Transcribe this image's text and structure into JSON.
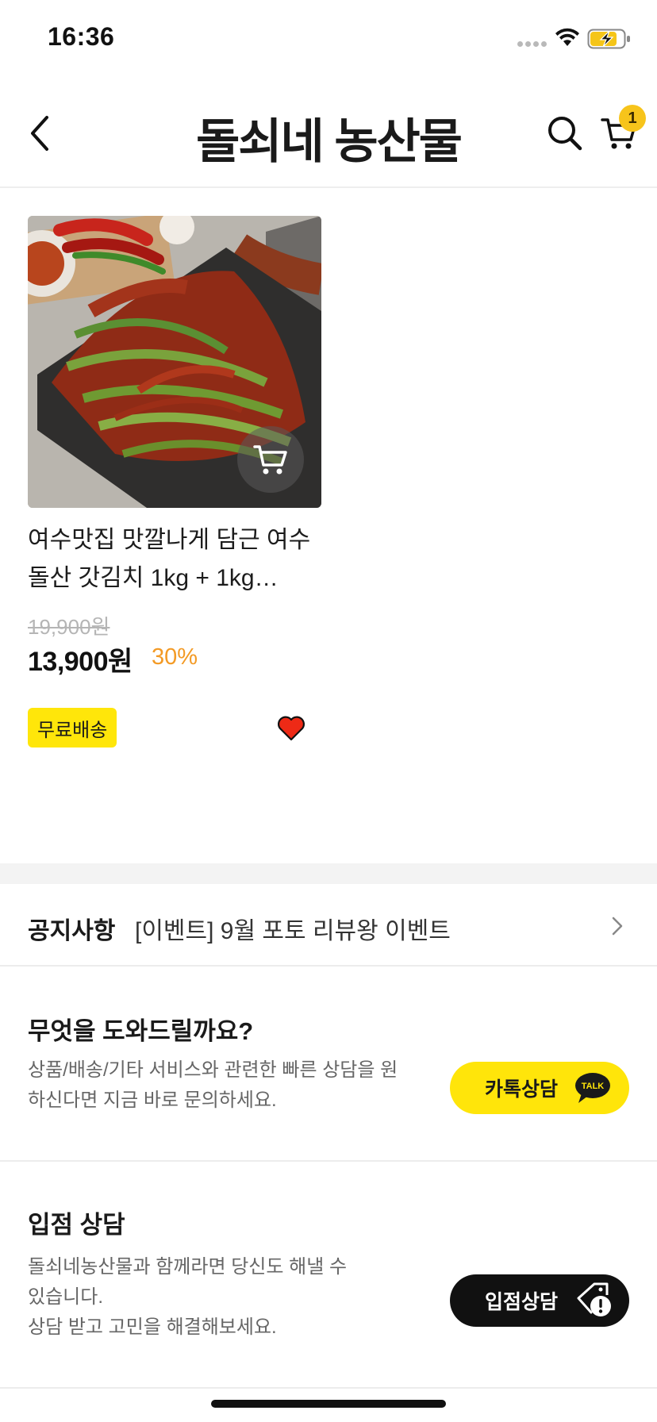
{
  "status_bar": {
    "time": "16:36",
    "icons": [
      "signal-dots-icon",
      "wifi-icon",
      "battery-charging-icon"
    ]
  },
  "header": {
    "title": "돌쇠네 농산물",
    "back_icon": "back-chevron-icon",
    "search_icon": "search-icon",
    "cart_icon": "cart-icon",
    "cart_count": "1"
  },
  "product": {
    "name": "여수맛집 맛깔나게 담근 여수 돌산 갓김치 1kg + 1kg…",
    "original_price": "19,900원",
    "sale_price": "13,900원",
    "discount": "30%",
    "badge": "무료배송",
    "wish_icon": "heart-icon",
    "image_cart_icon": "cart-icon"
  },
  "notice": {
    "label": "공지사항",
    "text": "[이벤트] 9월 포토 리뷰왕 이벤트"
  },
  "help": {
    "title": "무엇을 도와드릴까요?",
    "description": "상품/배송/기타 서비스와 관련한 빠른 상담을 원하신다면 지금 바로 문의하세요.",
    "button_label": "카톡상담",
    "button_icon_text": "TALK"
  },
  "partner": {
    "title": "입점 상담",
    "description_lines": [
      "돌쇠네농산물과 함께라면 당신도 해낼 수",
      "있습니다.",
      "상담 받고 고민을 해결해보세요."
    ],
    "button_label": "입점상담"
  },
  "colors": {
    "accent_yellow": "#ffe50a",
    "badge_yellow": "#f7c41b",
    "discount_orange": "#f39a25",
    "heart_red": "#ee2a16"
  }
}
